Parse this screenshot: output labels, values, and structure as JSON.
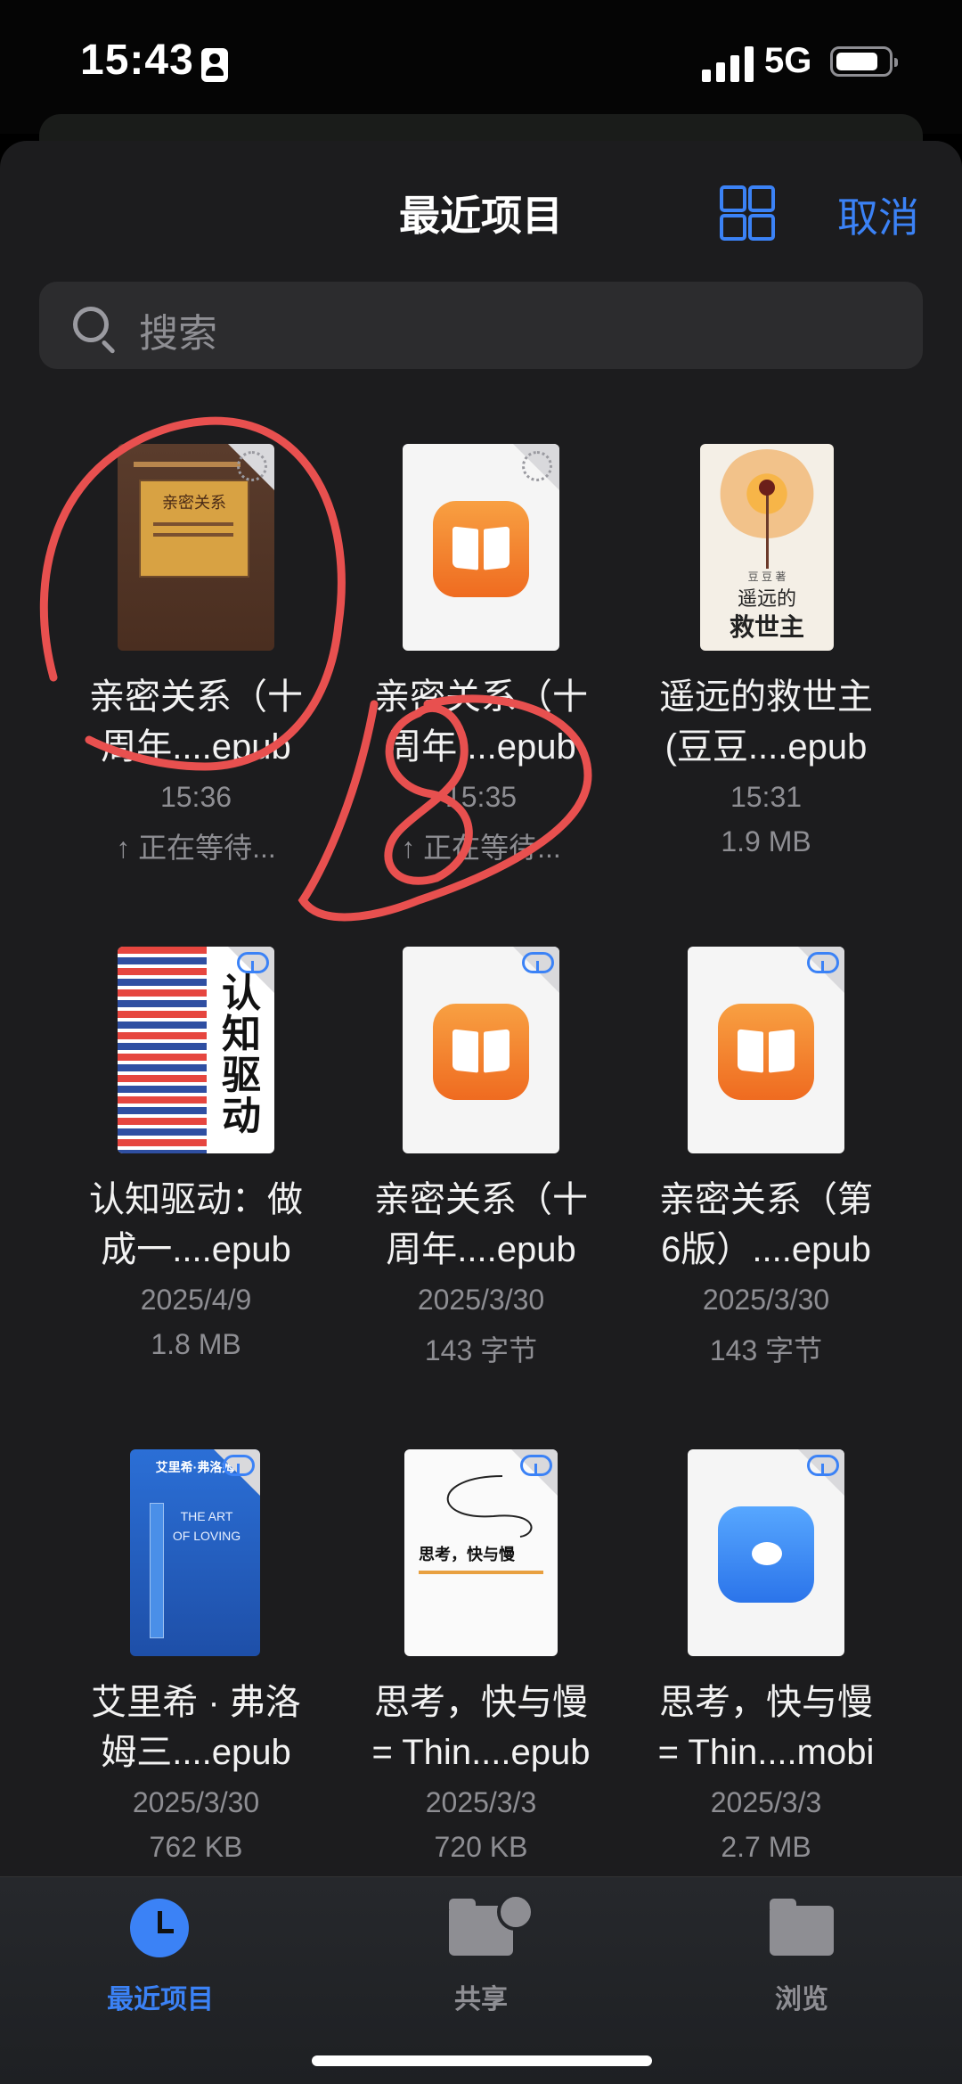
{
  "status_bar": {
    "time": "15:43",
    "network": "5G"
  },
  "header": {
    "title": "最近项目",
    "cancel_label": "取消"
  },
  "search": {
    "placeholder": "搜索"
  },
  "files": [
    {
      "name_line1": "亲密关系（十",
      "name_line2": "周年....epub",
      "date": "15:36",
      "detail": "↑ 正在等待...",
      "thumb": "cover-intimate"
    },
    {
      "name_line1": "亲密关系（十",
      "name_line2": "周年....epub",
      "date": "15:35",
      "detail": "↑ 正在等待...",
      "thumb": "books-icon"
    },
    {
      "name_line1": "遥远的救世主",
      "name_line2": "(豆豆....epub",
      "date": "15:31",
      "detail": "1.9 MB",
      "thumb": "cover-savior"
    },
    {
      "name_line1": "认知驱动：做",
      "name_line2": "成一....epub",
      "date": "2025/4/9",
      "detail": "1.8 MB",
      "thumb": "cover-cognitive"
    },
    {
      "name_line1": "亲密关系（十",
      "name_line2": "周年....epub",
      "date": "2025/3/30",
      "detail": "143 字节",
      "thumb": "books-icon"
    },
    {
      "name_line1": "亲密关系（第",
      "name_line2": "6版）....epub",
      "date": "2025/3/30",
      "detail": "143 字节",
      "thumb": "books-icon"
    },
    {
      "name_line1": "艾里希 · 弗洛",
      "name_line2": "姆三....epub",
      "date": "2025/3/30",
      "detail": "762 KB",
      "thumb": "cover-art-of-loving"
    },
    {
      "name_line1": "思考，快与慢",
      "name_line2": "= Thin....epub",
      "date": "2025/3/3",
      "detail": "720 KB",
      "thumb": "cover-thinking"
    },
    {
      "name_line1": "思考，快与慢",
      "name_line2": "= Thin....mobi",
      "date": "2025/3/3",
      "detail": "2.7 MB",
      "thumb": "chat-icon"
    }
  ],
  "covers": {
    "intimate_title": "亲密关系",
    "savior_title_1": "遥远的",
    "savior_title_2": "救世主",
    "savior_author": "豆 豆 著",
    "cognitive_title": "认知驱动",
    "loving_author": "艾里希·弗洛姆",
    "loving_title": "THE ART OF LOVING",
    "thinking_title": "思考，快与慢"
  },
  "tabbar": {
    "recent": "最近项目",
    "shared": "共享",
    "browse": "浏览"
  },
  "colors": {
    "accent": "#3b82f6",
    "sheet": "#1c1c1e",
    "annotation": "#e8504f"
  }
}
